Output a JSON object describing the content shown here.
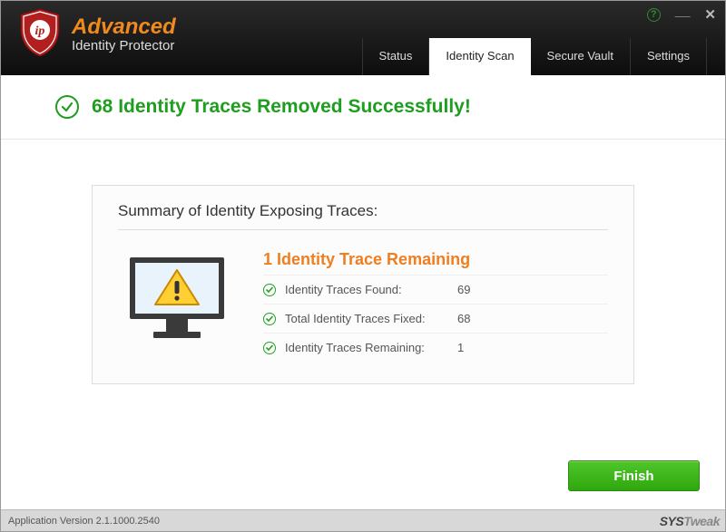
{
  "app": {
    "brand": "Advanced",
    "subtitle": "Identity Protector",
    "version_label": "Application Version 2.1.1000.2540",
    "watermark_a": "SYS",
    "watermark_b": "Tweak"
  },
  "tabs": {
    "status": "Status",
    "identity_scan": "Identity Scan",
    "secure_vault": "Secure Vault",
    "settings": "Settings"
  },
  "banner": {
    "message": "68 Identity Traces Removed Successfully!"
  },
  "summary": {
    "title": "Summary of Identity Exposing Traces:",
    "headline": "1 Identity Trace Remaining",
    "rows": {
      "found_label": "Identity Traces Found:",
      "found_value": "69",
      "fixed_label": "Total Identity Traces Fixed:",
      "fixed_value": "68",
      "remaining_label": "Identity Traces Remaining:",
      "remaining_value": "1"
    }
  },
  "actions": {
    "finish": "Finish"
  }
}
